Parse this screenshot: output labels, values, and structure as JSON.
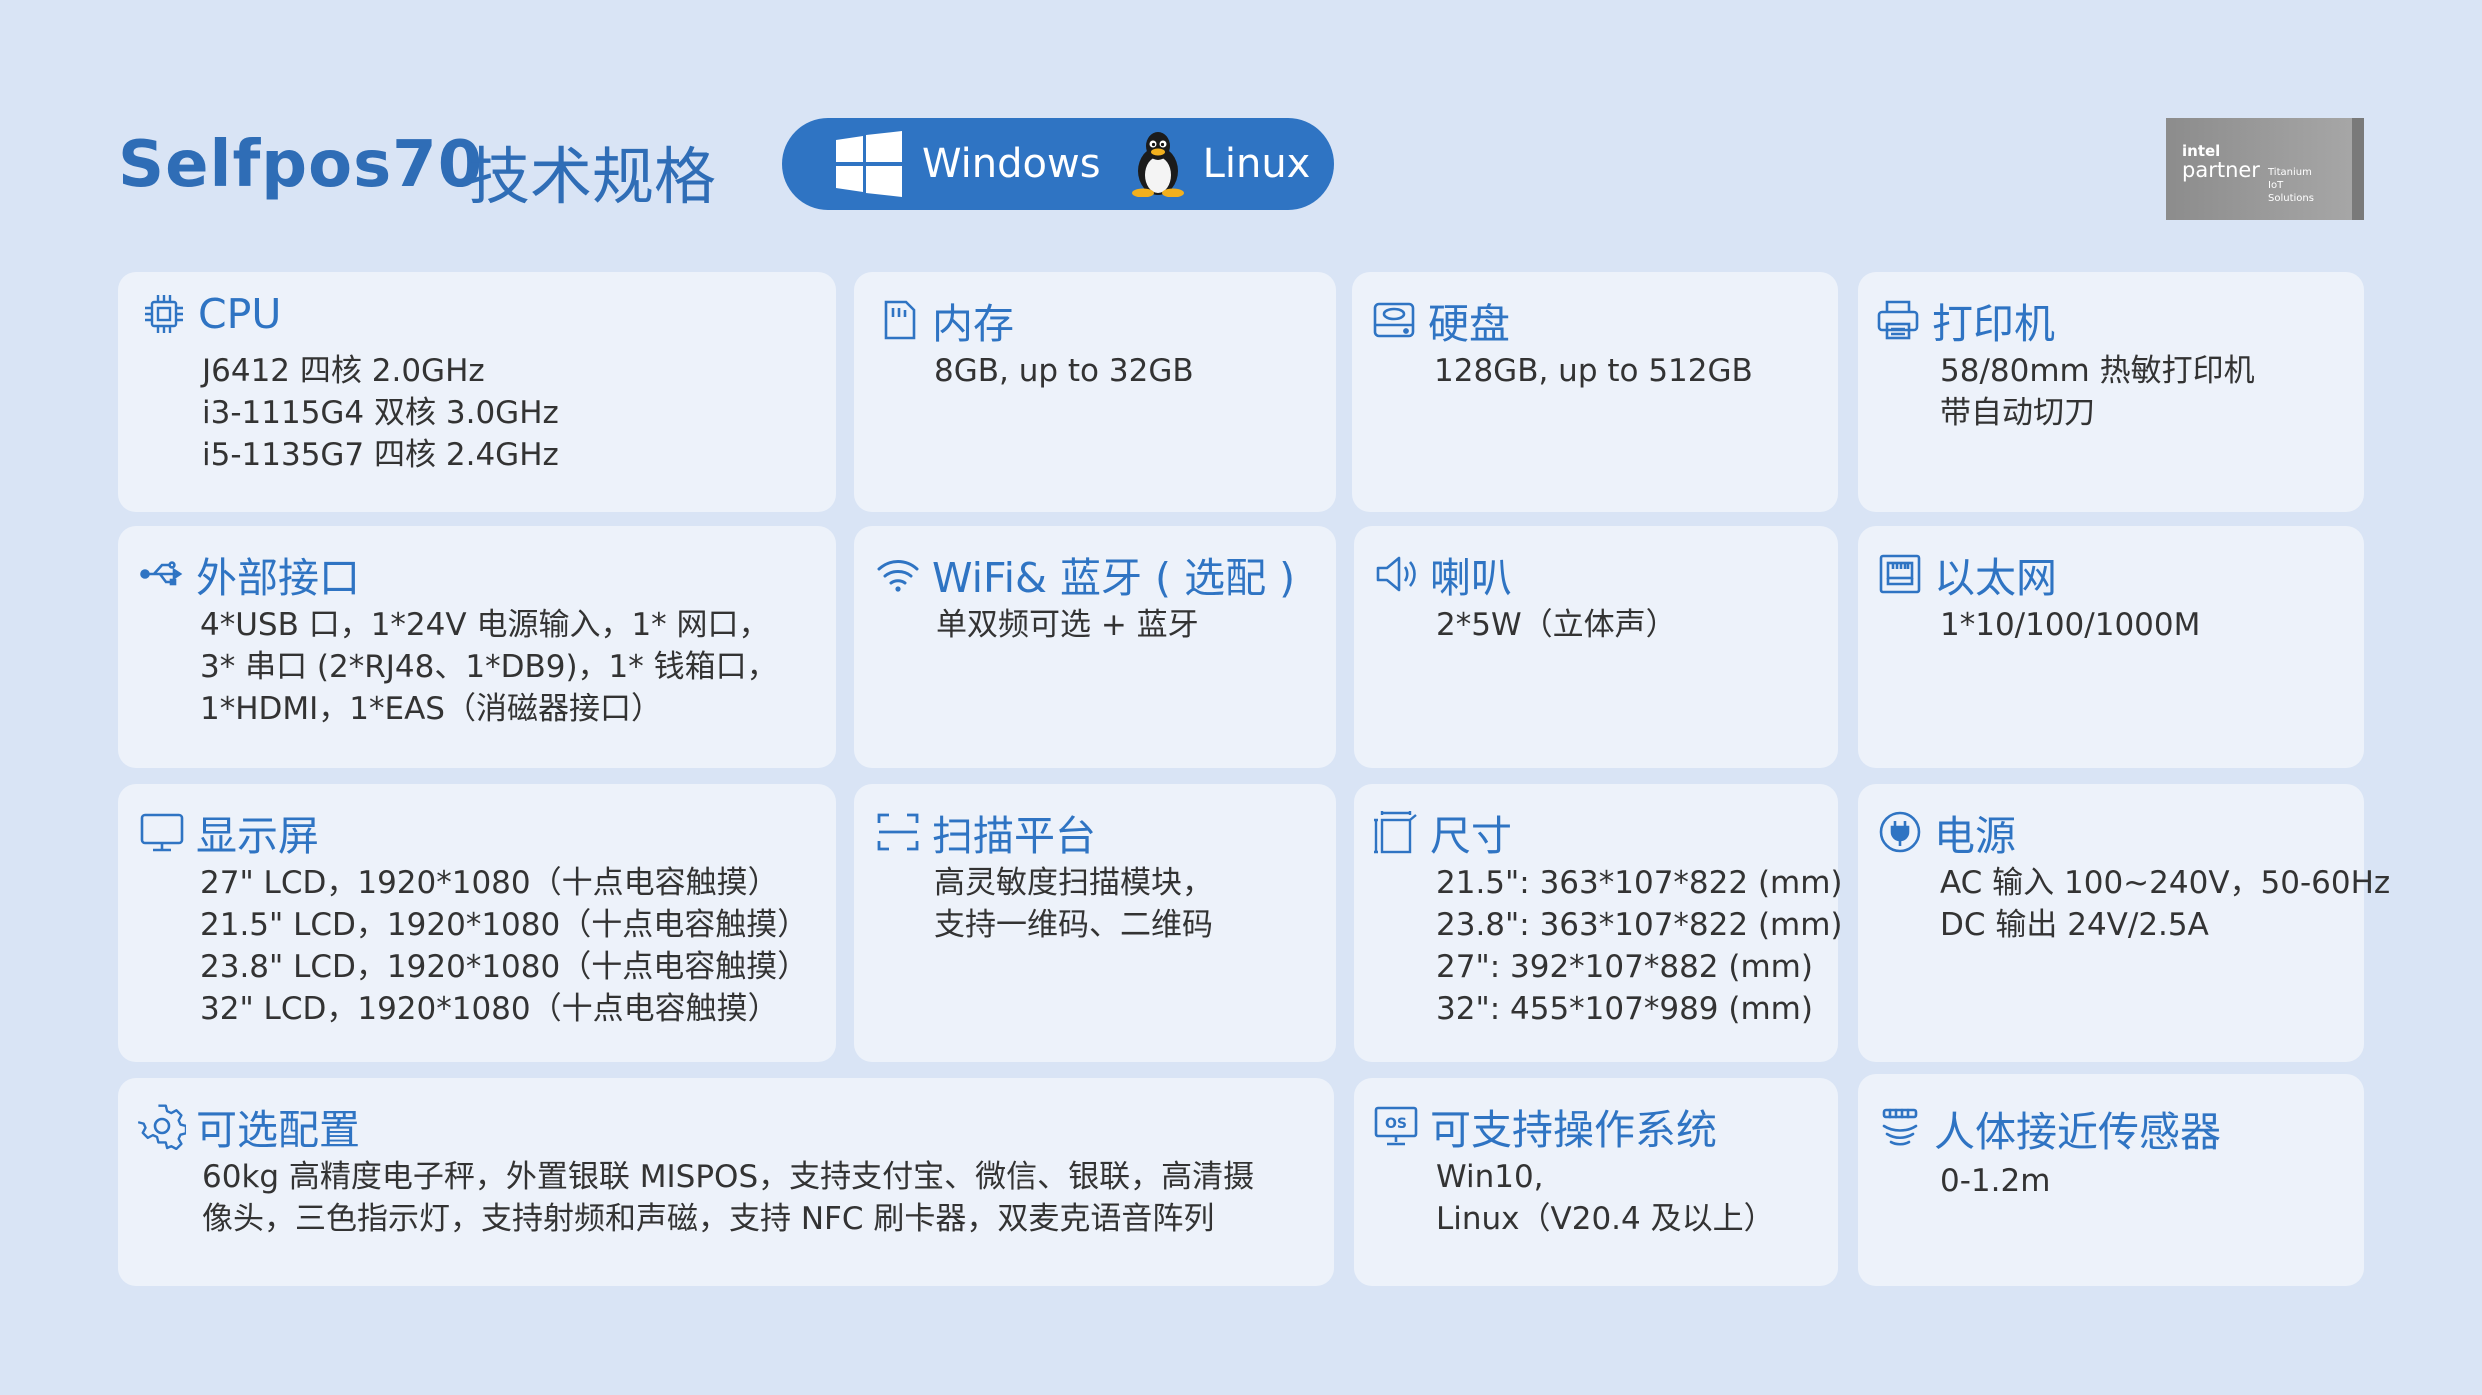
{
  "header": {
    "model": "Selfpos70",
    "title": "技术规格",
    "os_pill": {
      "windows_label": "Windows",
      "linux_label": "Linux"
    },
    "badge": {
      "intel": "intel",
      "partner": "partner",
      "subtitle_lines": [
        "Titanium",
        "IoT",
        "Solutions"
      ]
    }
  },
  "colors": {
    "background": "#d9e4f5",
    "card": "#edf2fa",
    "accent": "#2f74c3",
    "text": "#333333"
  },
  "specs": [
    {
      "label": "CPU",
      "icon": "cpu-icon",
      "lines": [
        "J6412 四核 2.0GHz",
        "i3-1115G4 双核 3.0GHz",
        "i5-1135G7 四核 2.4GHz"
      ]
    },
    {
      "label": "内存",
      "icon": "memory-card-icon",
      "lines": [
        "8GB, up to 32GB"
      ]
    },
    {
      "label": "硬盘",
      "icon": "hard-disk-icon",
      "lines": [
        "128GB, up to 512GB"
      ]
    },
    {
      "label": "打印机",
      "icon": "printer-icon",
      "lines": [
        "58/80mm 热敏打印机",
        "带自动切刀"
      ]
    },
    {
      "label": "外部接口",
      "icon": "usb-icon",
      "lines": [
        "4*USB 口，1*24V 电源输入，1* 网口，",
        "3* 串口 (2*RJ48、1*DB9)，1* 钱箱口，",
        "1*HDMI，1*EAS（消磁器接口）"
      ]
    },
    {
      "label": "WiFi& 蓝牙 ( 选配 )",
      "icon": "wifi-icon",
      "lines": [
        "单双频可选 + 蓝牙"
      ]
    },
    {
      "label": "喇叭",
      "icon": "speaker-icon",
      "lines": [
        "2*5W（立体声）"
      ]
    },
    {
      "label": "以太网",
      "icon": "ethernet-icon",
      "lines": [
        "1*10/100/1000M"
      ]
    },
    {
      "label": "显示屏",
      "icon": "monitor-icon",
      "lines": [
        "27\" LCD，1920*1080（十点电容触摸）",
        "21.5\" LCD，1920*1080（十点电容触摸）",
        "23.8\" LCD，1920*1080（十点电容触摸）",
        "32\" LCD，1920*1080（十点电容触摸）"
      ]
    },
    {
      "label": "扫描平台",
      "icon": "scan-icon",
      "lines": [
        "高灵敏度扫描模块，",
        "支持一维码、二维码"
      ]
    },
    {
      "label": "尺寸",
      "icon": "dimensions-icon",
      "lines": [
        "21.5\": 363*107*822 (mm)",
        "23.8\": 363*107*822 (mm)",
        "27\": 392*107*882 (mm)",
        "32\": 455*107*989 (mm)"
      ]
    },
    {
      "label": "电源",
      "icon": "power-plug-icon",
      "lines": [
        "AC 输入 100~240V，50-60Hz",
        "DC 输出 24V/2.5A"
      ]
    },
    {
      "label": "可选配置",
      "icon": "gear-icon",
      "lines": [
        "60kg 高精度电子秤，外置银联 MISPOS，支持支付宝、微信、银联，高清摄",
        "像头，三色指示灯，支持射频和声磁，支持 NFC 刷卡器，双麦克语音阵列"
      ]
    },
    {
      "label": "可支持操作系统",
      "icon": "os-icon",
      "lines": [
        "Win10,",
        "Linux（V20.4 及以上）"
      ]
    },
    {
      "label": "人体接近传感器",
      "icon": "proximity-sensor-icon",
      "lines": [
        "0-1.2m"
      ]
    }
  ]
}
